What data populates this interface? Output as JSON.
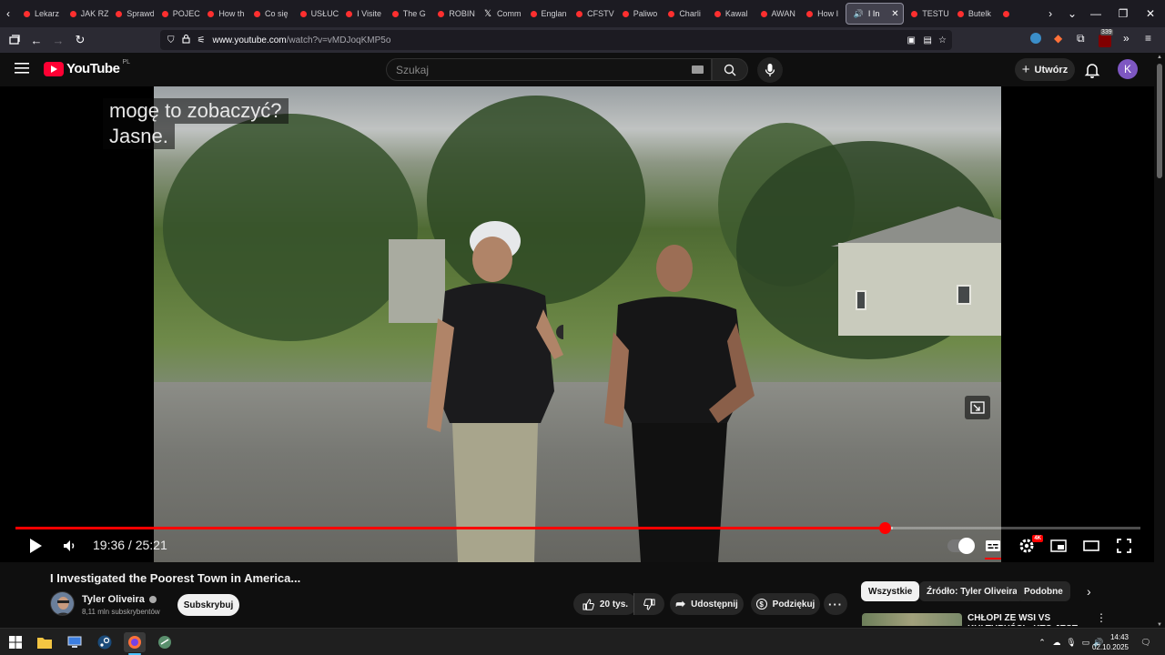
{
  "browser": {
    "tabs": [
      {
        "label": "Lekarz",
        "favicon": "youtube-icon"
      },
      {
        "label": "JAK RZ",
        "favicon": "youtube-icon"
      },
      {
        "label": "Sprawd",
        "favicon": "youtube-icon"
      },
      {
        "label": "POJECH",
        "favicon": "youtube-icon"
      },
      {
        "label": "How th",
        "favicon": "youtube-icon"
      },
      {
        "label": "Co się",
        "favicon": "youtube-icon"
      },
      {
        "label": "USŁUC",
        "favicon": "youtube-icon"
      },
      {
        "label": "I Visite",
        "favicon": "youtube-icon"
      },
      {
        "label": "The G",
        "favicon": "youtube-icon"
      },
      {
        "label": "ROBIN",
        "favicon": "youtube-icon"
      },
      {
        "label": "Comm",
        "favicon": "x-icon"
      },
      {
        "label": "Englan",
        "favicon": "youtube-icon"
      },
      {
        "label": "CFSTV",
        "favicon": "youtube-icon"
      },
      {
        "label": "Paliwo",
        "favicon": "youtube-icon"
      },
      {
        "label": "Charli",
        "favicon": "youtube-icon"
      },
      {
        "label": "Kawal",
        "favicon": "youtube-icon"
      },
      {
        "label": "AWAN",
        "favicon": "youtube-icon"
      },
      {
        "label": "How I",
        "favicon": "youtube-icon"
      }
    ],
    "active_tab": {
      "label": "I In",
      "favicon": "youtube-icon"
    },
    "tabs_after": [
      {
        "label": "TESTU",
        "favicon": "youtube-icon"
      },
      {
        "label": "Butelk",
        "favicon": "youtube-icon"
      },
      {
        "label": "",
        "favicon": "youtube-icon"
      }
    ],
    "url_host": "www.youtube.com",
    "url_path": "/watch?v=vMDJoqKMP5o",
    "extension_badge": "339"
  },
  "youtube": {
    "logo_text": "YouTube",
    "country_code": "PL",
    "search_placeholder": "Szukaj",
    "create_label": "Utwórz",
    "avatar_letter": "K"
  },
  "player": {
    "caption_lines": [
      "mogę to zobaczyć?",
      "Jasne."
    ],
    "current_time": "19:36",
    "duration": "25:21",
    "time_display": "19:36 / 25:21",
    "played_fraction": 0.773,
    "loaded_fraction": 0.78,
    "quality_badge": "4K"
  },
  "video": {
    "title": "I Investigated the Poorest Town in America...",
    "channel_name": "Tyler Oliveira",
    "subscribers": "8,11 mln subskrybentów",
    "subscribe_label": "Subskrybuj",
    "like_count": "20 tys.",
    "share_label": "Udostępnij",
    "thanks_label": "Podziękuj"
  },
  "recommendations": {
    "chips": [
      "Wszystkie",
      "Źródło: Tyler Oliveira",
      "Podobne"
    ],
    "first_title": "CHŁOPI ZE WSI VS KULTURYŚCI - KTO JEST"
  },
  "taskbar": {
    "time": "14:43",
    "date": "02.10.2025"
  },
  "colors": {
    "youtube_red": "#ff0033",
    "progress_red": "#ff0000",
    "page_bg": "#0f0f0f",
    "browser_tab_bg": "#1c1b22"
  }
}
